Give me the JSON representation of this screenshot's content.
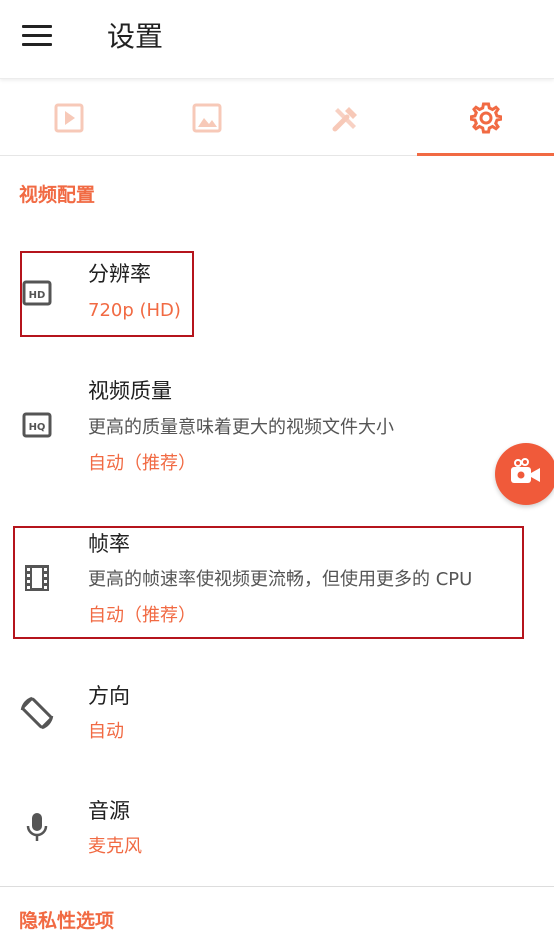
{
  "header": {
    "title": "设置"
  },
  "tabs": [
    {
      "icon": "video-icon",
      "active": false
    },
    {
      "icon": "image-icon",
      "active": false
    },
    {
      "icon": "tools-icon",
      "active": false
    },
    {
      "icon": "gear-icon",
      "active": true
    }
  ],
  "colors": {
    "accent": "#f16a43",
    "inactive_icon": "#f7c9b8",
    "highlight": "#b5141c"
  },
  "section": {
    "title": "视频配置"
  },
  "items": [
    {
      "icon": "hd-icon",
      "title": "分辨率",
      "value": "720p (HD)"
    },
    {
      "icon": "hq-icon",
      "title": "视频质量",
      "description": "更高的质量意味着更大的视频文件大小",
      "value": "自动（推荐）"
    },
    {
      "icon": "film-icon",
      "title": "帧率",
      "description": "更高的帧速率使视频更流畅，但使用更多的 CPU",
      "value": "自动（推荐）"
    },
    {
      "icon": "screen-rotation-icon",
      "title": "方向",
      "value": "自动"
    },
    {
      "icon": "microphone-icon",
      "title": "音源",
      "value": "麦克风"
    }
  ],
  "next_section": {
    "title": "隐私性选项"
  }
}
